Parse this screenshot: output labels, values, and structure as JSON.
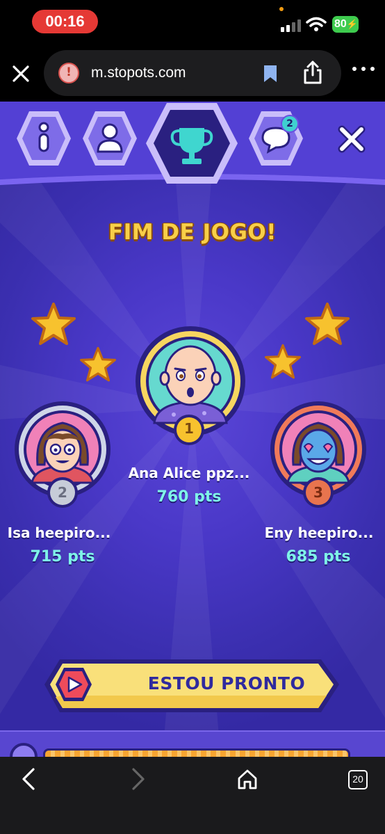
{
  "status_bar": {
    "time": "00:16",
    "battery": "80"
  },
  "browser": {
    "url": "m.stopots.com",
    "tabs_count": "20"
  },
  "game_nav": {
    "chat_badge": "2",
    "active_tab": "trophy"
  },
  "game": {
    "title": "FIM DE JOGO!",
    "podium": [
      {
        "place": "1",
        "name": "Ana Alice ppz...",
        "points": "760 pts"
      },
      {
        "place": "2",
        "name": "Isa heepiro...",
        "points": "715 pts"
      },
      {
        "place": "3",
        "name": "Eny heepiro...",
        "points": "685 pts"
      }
    ],
    "ready_button_label": "ESTOU PRONTO"
  },
  "colors": {
    "game_bg": "#3b2fb0",
    "gold": "#f8cf48",
    "points": "#7ff3e8",
    "button": "#f9e07a",
    "status_time": "#e53935"
  }
}
